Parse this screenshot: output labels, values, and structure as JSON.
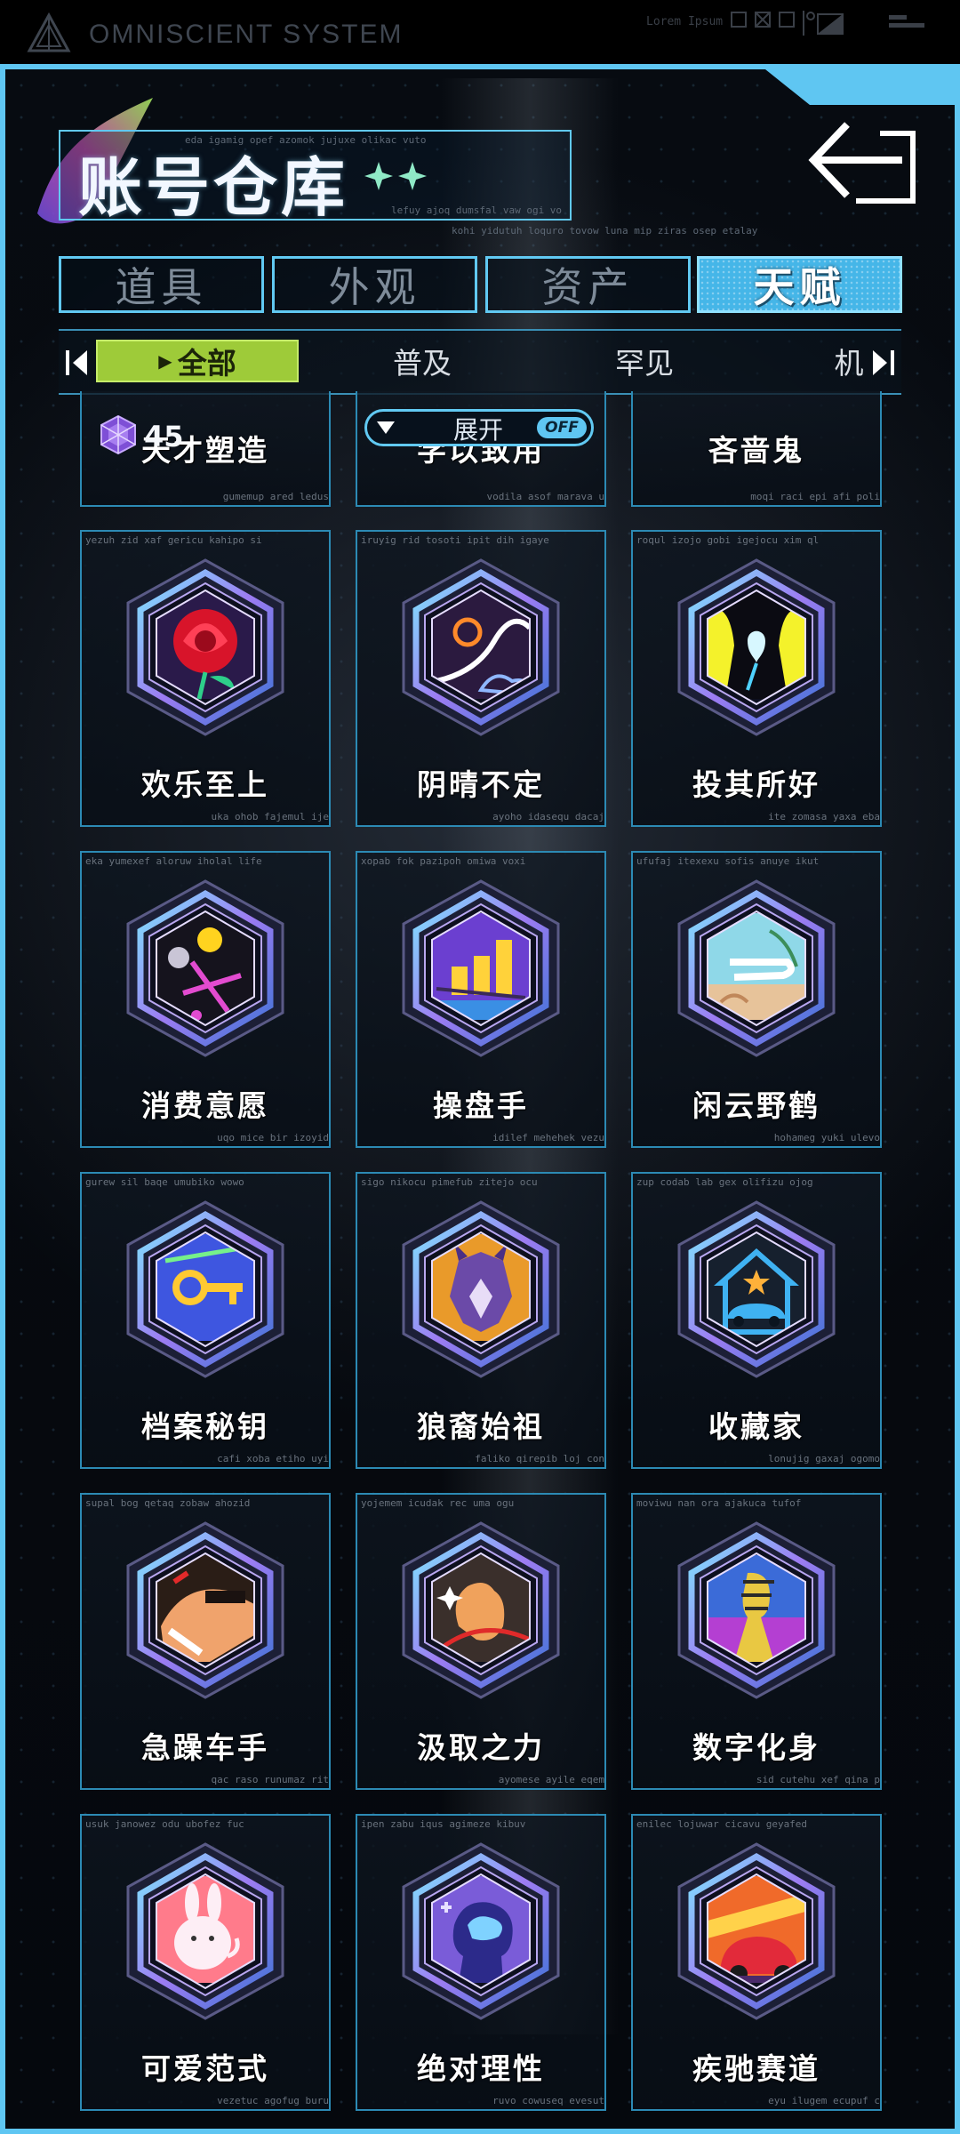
{
  "system": {
    "title": "OMNISCIENT SYSTEM",
    "lorem": "Lorem Ipsum"
  },
  "header": {
    "title": "账号仓库",
    "micro_1": "eda igamig opef azomok jujuxe olikac vuto",
    "micro_2": "lefuy ajoq dumsfal vaw ogi vo",
    "micro_3": "kohi yidutuh loquro tovow luna mip ziras osep etalay"
  },
  "tabs": [
    {
      "label": "道具",
      "active": false
    },
    {
      "label": "外观",
      "active": false
    },
    {
      "label": "资产",
      "active": false
    },
    {
      "label": "天赋",
      "active": true
    }
  ],
  "subtabs": [
    {
      "label": "全部",
      "active": true
    },
    {
      "label": "普及",
      "active": false
    },
    {
      "label": "罕见",
      "active": false
    },
    {
      "label": "机",
      "active": false
    }
  ],
  "expand": {
    "label": "展开",
    "toggle": "OFF"
  },
  "count": "45",
  "colors": {
    "accent": "#5fc6f2",
    "active_sub": "#9ecb39"
  },
  "partial_cards": [
    {
      "name": "天才塑造",
      "code_bot": "gumemup ared ledus"
    },
    {
      "name": "学以致用",
      "code_bot": "vodila asof marava u"
    },
    {
      "name": "吝啬鬼",
      "code_bot": "moqi raci epi afi poli"
    }
  ],
  "cards": [
    {
      "name": "欢乐至上",
      "code_top": "yezuh zid xaf gericu kahipo si",
      "code_bot": "uka ohob fajemul ije",
      "icon": "rose-icon"
    },
    {
      "name": "阴晴不定",
      "code_top": "iruyig rid tosoti ipit dih igaye",
      "code_bot": "ayoho idasequ dacaj",
      "icon": "sun-cloud-icon"
    },
    {
      "name": "投其所好",
      "code_top": "roqul izojo gobi igejocu xim ql",
      "code_bot": "ite zomasa yaxa eba",
      "icon": "heart-silhouette-icon"
    },
    {
      "name": "消费意愿",
      "code_top": "eka yumexef aloruw iholal life",
      "code_bot": "uqo mice bir izoyid",
      "icon": "shopping-icon"
    },
    {
      "name": "操盘手",
      "code_top": "xopab fok pazipoh omiwa voxi",
      "code_bot": "idilef mehehek vezu",
      "icon": "bar-chart-icon"
    },
    {
      "name": "闲云野鹤",
      "code_top": "ufufaj itexexu sofis anuye ikut",
      "code_bot": "hohameg yuki ulevo",
      "icon": "cloud-landscape-icon"
    },
    {
      "name": "档案秘钥",
      "code_top": "gurew sil baqe umubiko wowo",
      "code_bot": "cafi xoba etiho uyi",
      "icon": "key-icon"
    },
    {
      "name": "狼裔始祖",
      "code_top": "sigo nikocu pimefub zitejo ocu",
      "code_bot": "faliko qirepib loj con",
      "icon": "wolf-icon"
    },
    {
      "name": "收藏家",
      "code_top": "zup codab lab gex olifizu ojog",
      "code_bot": "lonujig gaxaj ogomo",
      "icon": "house-car-icon"
    },
    {
      "name": "急躁车手",
      "code_top": "supal bog qetaq zobaw ahozid",
      "code_bot": "qac raso runumaz rit",
      "icon": "driver-icon"
    },
    {
      "name": "汲取之力",
      "code_top": "yojemem icudak rec uma ogu",
      "code_bot": "ayomese ayile eqem",
      "icon": "hand-icon"
    },
    {
      "name": "数字化身",
      "code_top": "moviwu nan ora ajakuca tufof",
      "code_bot": "sid cutehu xef qina p",
      "icon": "avatar-icon"
    },
    {
      "name": "可爱范式",
      "code_top": "usuk janowez odu ubofez fuc",
      "code_bot": "vezetuc agofug buru",
      "icon": "bunny-icon"
    },
    {
      "name": "绝对理性",
      "code_top": "ipen zabu iqus agimeze kibuv",
      "code_bot": "ruvo cowuseq evesut",
      "icon": "brain-icon"
    },
    {
      "name": "疾驰赛道",
      "code_top": "enilec lojuwar cicavu geyafed",
      "code_bot": "eyu ilugem ecupuf c",
      "icon": "race-car-icon"
    }
  ]
}
